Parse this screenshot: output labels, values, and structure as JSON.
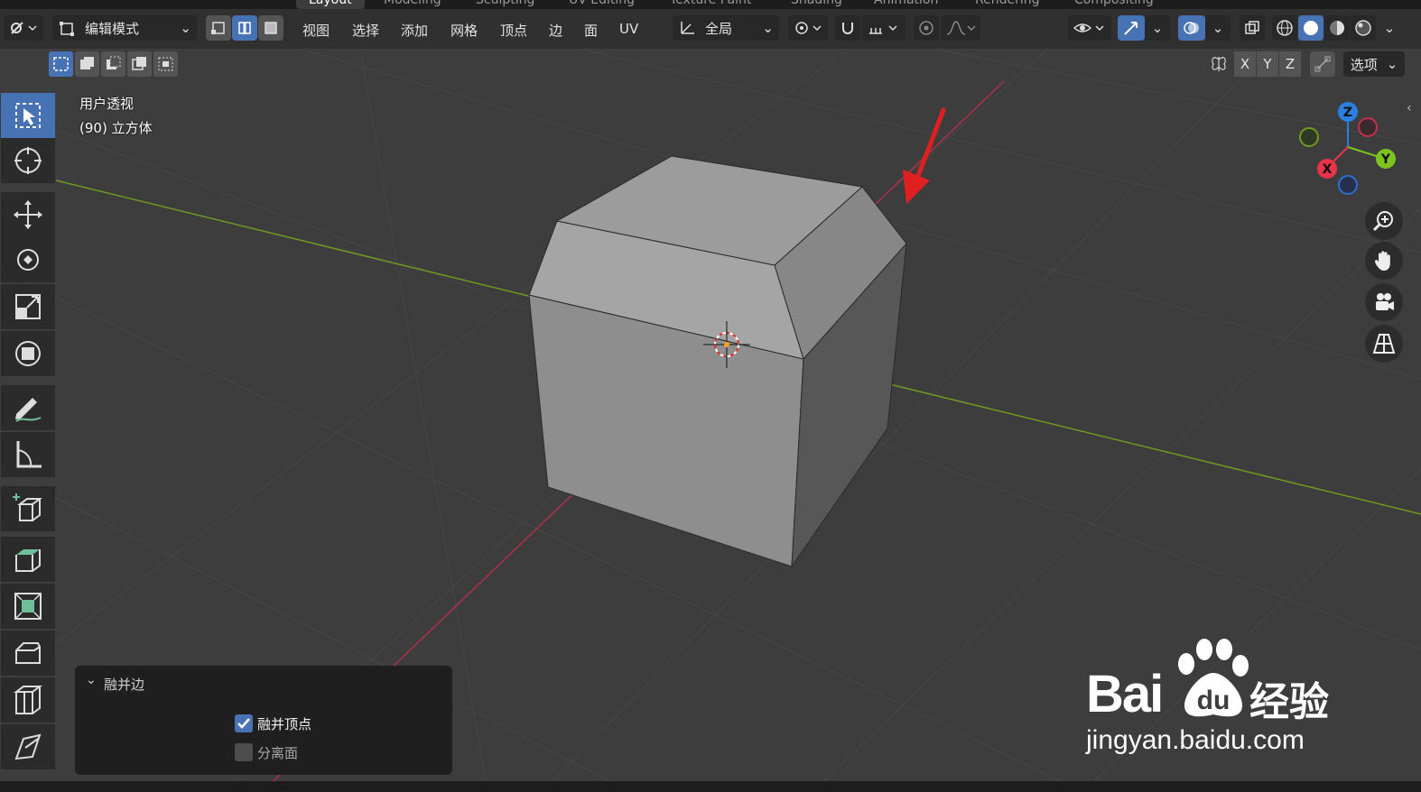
{
  "top_tabs": [
    "Layout",
    "Modeling",
    "Sculpting",
    "UV Editing",
    "Texture Paint",
    "Shading",
    "Animation",
    "Rendering",
    "Compositing"
  ],
  "header": {
    "mode_label": "编辑模式",
    "menus": [
      "视图",
      "选择",
      "添加",
      "网格",
      "顶点",
      "边",
      "面",
      "UV"
    ],
    "transform_orientation": "全局",
    "axis_labels": [
      "X",
      "Y",
      "Z"
    ],
    "options_label": "选项"
  },
  "viewport_info": {
    "view_name": "用户透视",
    "object_info": "(90) 立方体"
  },
  "gizmo": {
    "z_label": "Z",
    "y_label": "Y",
    "x_label": "X",
    "colors": {
      "x": "#e8334a",
      "y": "#7cc31e",
      "z": "#2b7fe0"
    }
  },
  "tools": [
    "select-box",
    "cursor",
    "move",
    "rotate",
    "scale",
    "transform",
    "annotate",
    "measure",
    "add-cube",
    "extrude",
    "inset",
    "bevel",
    "loop-cut",
    "knife"
  ],
  "nav_buttons": [
    "zoom",
    "pan",
    "camera",
    "ortho-toggle"
  ],
  "operator_panel": {
    "title": "融并边",
    "options": [
      {
        "label": "融并顶点",
        "checked": true
      },
      {
        "label": "分离面",
        "checked": false
      }
    ]
  },
  "watermark": {
    "brand": "Bai",
    "brand_tail": "经验",
    "url": "jingyan.baidu.com"
  },
  "colors": {
    "accent": "#4772b3",
    "x_axis": "#c2304a",
    "y_axis": "#6f9a1f",
    "arrow": "#e02020"
  }
}
